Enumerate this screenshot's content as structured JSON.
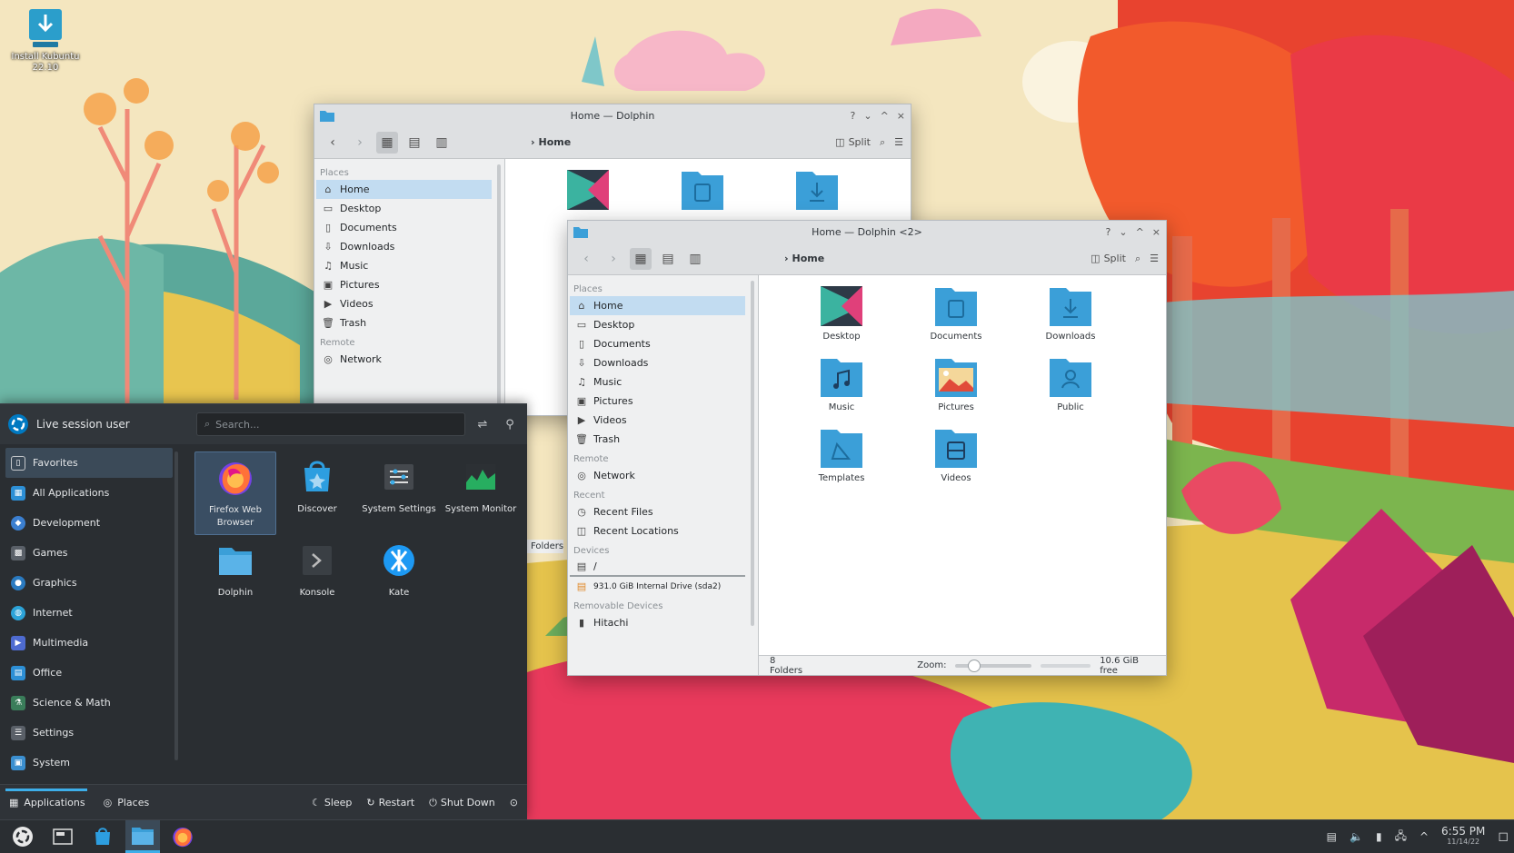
{
  "colors": {
    "accent": "#3daee9",
    "folder": "#3b9fd8",
    "selection": "#c2dcf1",
    "panel": "#2a2e32"
  },
  "desktop": {
    "install_label_1": "Install Kubuntu",
    "install_label_2": "22.10"
  },
  "dolphin_back": {
    "title": "Home — Dolphin",
    "breadcrumb": "Home",
    "split_label": "Split",
    "places_sections": {
      "places": "Places",
      "remote": "Remote"
    },
    "places": [
      "Home",
      "Desktop",
      "Documents",
      "Downloads",
      "Music",
      "Pictures",
      "Videos",
      "Trash"
    ],
    "remote": [
      "Network"
    ],
    "status_fragment": "Folders",
    "titlebar_buttons": [
      "?",
      "⌄",
      "^",
      "×"
    ]
  },
  "dolphin_front": {
    "title": "Home — Dolphin <2>",
    "breadcrumb": "Home",
    "split_label": "Split",
    "titlebar_buttons": [
      "?",
      "⌄",
      "^",
      "×"
    ],
    "sections": {
      "places": "Places",
      "remote": "Remote",
      "recent": "Recent",
      "devices": "Devices",
      "removable": "Removable Devices"
    },
    "places": [
      "Home",
      "Desktop",
      "Documents",
      "Downloads",
      "Music",
      "Pictures",
      "Videos",
      "Trash"
    ],
    "remote": [
      "Network"
    ],
    "recent": [
      "Recent Files",
      "Recent Locations"
    ],
    "devices": [
      "/",
      "931.0 GiB Internal Drive (sda2)"
    ],
    "removable": [
      "Hitachi"
    ],
    "files": [
      "Desktop",
      "Documents",
      "Downloads",
      "Music",
      "Pictures",
      "Public",
      "Templates",
      "Videos"
    ],
    "status": {
      "count": "8 Folders",
      "zoom_label": "Zoom:",
      "zoom_value": 0.25,
      "free": "10.6 GiB free"
    }
  },
  "launcher": {
    "user": "Live session user",
    "search_placeholder": "Search...",
    "categories": [
      "Favorites",
      "All Applications",
      "Development",
      "Games",
      "Graphics",
      "Internet",
      "Multimedia",
      "Office",
      "Science & Math",
      "Settings",
      "System"
    ],
    "apps": [
      {
        "label": "Firefox Web Browser",
        "icon": "firefox-icon"
      },
      {
        "label": "Discover",
        "icon": "discover-icon"
      },
      {
        "label": "System Settings",
        "icon": "settings-icon"
      },
      {
        "label": "System Monitor",
        "icon": "monitor-icon"
      },
      {
        "label": "Dolphin",
        "icon": "dolphin-icon"
      },
      {
        "label": "Konsole",
        "icon": "konsole-icon"
      },
      {
        "label": "Kate",
        "icon": "kate-icon"
      }
    ],
    "footer": {
      "applications": "Applications",
      "places": "Places",
      "sleep": "Sleep",
      "restart": "Restart",
      "shutdown": "Shut Down"
    }
  },
  "taskbar": {
    "time": "6:55 PM",
    "date": "11/14/22"
  }
}
